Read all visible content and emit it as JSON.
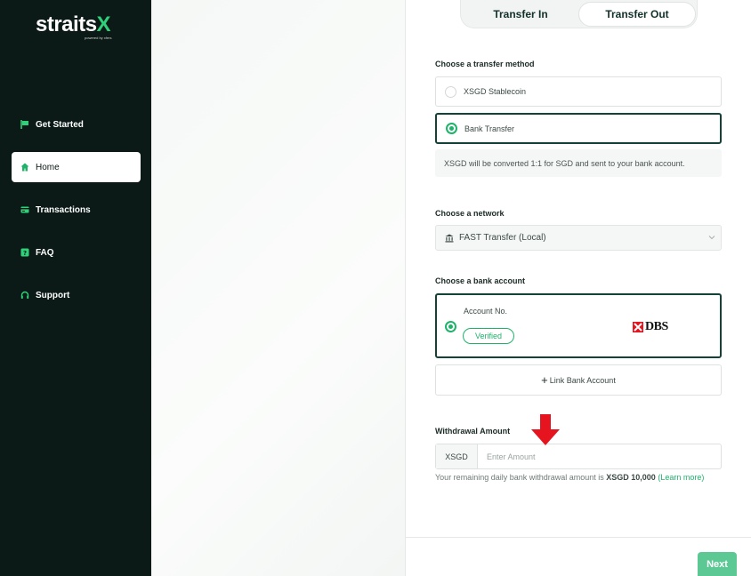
{
  "brand": {
    "logo_main": "straits",
    "logo_x": "X",
    "logo_sub": "powered by xfers"
  },
  "sidebar": {
    "items": [
      {
        "label": "Get Started",
        "icon": "flag-icon"
      },
      {
        "label": "Home",
        "icon": "home-icon",
        "active": true
      },
      {
        "label": "Transactions",
        "icon": "card-icon"
      },
      {
        "label": "FAQ",
        "icon": "question-icon"
      },
      {
        "label": "Support",
        "icon": "headset-icon"
      }
    ]
  },
  "tabs": {
    "in_label": "Transfer In",
    "out_label": "Transfer Out",
    "active": "Transfer Out"
  },
  "transfer_method": {
    "heading": "Choose a transfer method",
    "options": [
      {
        "label": "XSGD Stablecoin",
        "selected": false
      },
      {
        "label": "Bank Transfer",
        "selected": true
      }
    ],
    "note": "XSGD will be converted 1:1 for SGD and sent to your bank account."
  },
  "network": {
    "heading": "Choose a network",
    "selected": "FAST Transfer (Local)"
  },
  "bank_account": {
    "heading": "Choose a bank account",
    "account_label": "Account No.",
    "status": "Verified",
    "bank_name": "DBS",
    "link_label": "Link Bank Account"
  },
  "withdrawal": {
    "heading": "Withdrawal Amount",
    "currency": "XSGD",
    "placeholder": "Enter Amount",
    "hint_prefix": "Your remaining daily bank withdrawal amount is ",
    "hint_amount": "XSGD 10,000",
    "hint_link": "(Learn more)"
  },
  "footer": {
    "next_label": "Next"
  },
  "colors": {
    "sidebar_bg": "#0b1a16",
    "accent": "#1fb36a",
    "selected_border": "#124238",
    "next_button": "#5cc995",
    "arrow": "#e5141e"
  }
}
